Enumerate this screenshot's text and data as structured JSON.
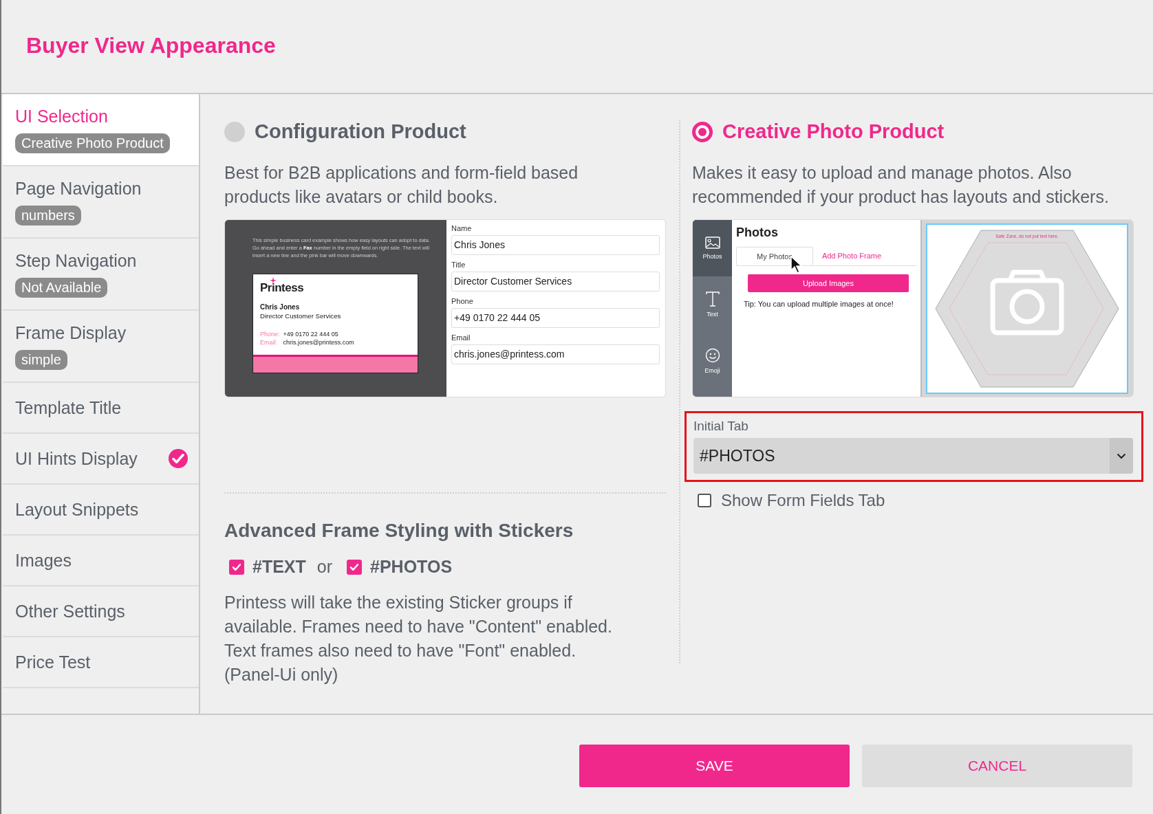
{
  "title": "Buyer View Appearance",
  "sidebar": {
    "items": [
      {
        "label": "UI Selection",
        "badge": "Creative Photo Product",
        "selected": true,
        "done": false
      },
      {
        "label": "Page Navigation",
        "badge": "numbers",
        "selected": false,
        "done": false
      },
      {
        "label": "Step Navigation",
        "badge": "Not Available",
        "selected": false,
        "done": false
      },
      {
        "label": "Frame Display",
        "badge": "simple",
        "selected": false,
        "done": false
      },
      {
        "label": "Template Title",
        "selected": false,
        "done": false
      },
      {
        "label": "UI Hints Display",
        "selected": false,
        "done": true
      },
      {
        "label": "Layout Snippets",
        "selected": false,
        "done": false
      },
      {
        "label": "Images",
        "selected": false,
        "done": false
      },
      {
        "label": "Other Settings",
        "selected": false,
        "done": false
      },
      {
        "label": "Price Test",
        "selected": false,
        "done": false
      }
    ]
  },
  "options": [
    {
      "kind": "configuration",
      "selected": false,
      "title": "Configuration Product",
      "description": "Best for B2B applications and form-field based products like avatars or child books.",
      "preview": {
        "intro": "This simple business card example shows how easy layouts can adopt to data. Go ahead and enter a **Fax** number in the empty field on right side. The text will insert a new line and the pink bar will move downwards.",
        "logo": "Printess",
        "card_name": "Chris Jones",
        "card_title": "Director Customer Services",
        "card_lines": [
          {
            "label": "Phone:",
            "value": "+49 0170 22 444 05"
          },
          {
            "label": "Email:",
            "value": "chris.jones@printess.com"
          }
        ],
        "fields": [
          {
            "label": "Name",
            "value": "Chris Jones"
          },
          {
            "label": "Title",
            "value": "Director Customer Services"
          },
          {
            "label": "Phone",
            "value": "+49 0170 22 444 05"
          },
          {
            "label": "Email",
            "value": "chris.jones@printess.com"
          }
        ]
      }
    },
    {
      "kind": "photo",
      "selected": true,
      "title": "Creative Photo Product",
      "description": "Makes it easy to upload and manage photos. Also recommended if your product has layouts and stickers.",
      "preview": {
        "nav": [
          {
            "kind": "photo",
            "label": "Photos",
            "selected": true
          },
          {
            "kind": "text",
            "label": "Text",
            "selected": false
          },
          {
            "kind": "emoji",
            "label": "Emoji",
            "selected": false
          }
        ],
        "panel_title": "Photos",
        "tabs": [
          {
            "label": "My Photos",
            "selected": true
          },
          {
            "label": "Add Photo Frame",
            "selected": false
          }
        ],
        "upload_button": "Upload Images",
        "tip": "Tip: You can upload multiple images at once!",
        "canvas_hint": "Safe Zone, do not put text here."
      }
    }
  ],
  "stickers": {
    "heading": "Advanced Frame Styling with Stickers",
    "options": [
      {
        "label": "#TEXT",
        "checked": true
      },
      {
        "label": "#PHOTOS",
        "checked": true
      }
    ],
    "separator": "or",
    "description": "Printess will take the existing Sticker groups if available. Frames need to have \"Content\" enabled. Text frames also need to have \"Font\" enabled. (Panel-Ui only)"
  },
  "photo_settings": {
    "initial_tab": {
      "label": "Initial Tab",
      "value": "#PHOTOS",
      "highlighted": true
    },
    "show_form_fields": {
      "label": "Show Form Fields Tab",
      "checked": false
    }
  },
  "buttons": [
    {
      "kind": "primary",
      "label": "SAVE"
    },
    {
      "kind": "secondary",
      "label": "CANCEL"
    }
  ]
}
